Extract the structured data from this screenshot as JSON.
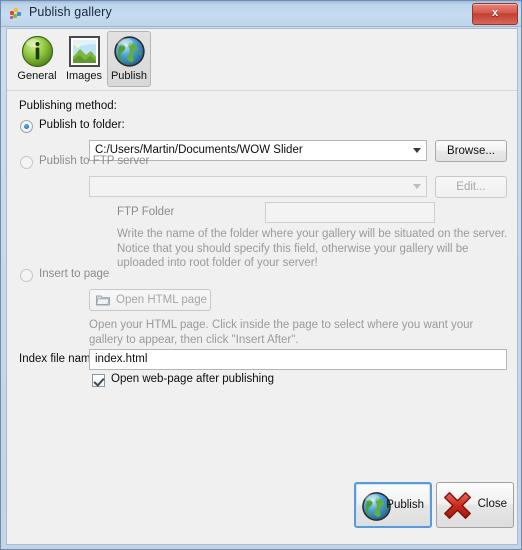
{
  "window": {
    "title": "Publish gallery",
    "app_icon": "colorful-squares-icon",
    "close_label": "x"
  },
  "toolbar": {
    "tabs": [
      {
        "label": "General",
        "icon": "info-globe-icon",
        "selected": false
      },
      {
        "label": "Images",
        "icon": "landscape-image-icon",
        "selected": false
      },
      {
        "label": "Publish",
        "icon": "globe-icon",
        "selected": true
      }
    ]
  },
  "panel": {
    "section_label": "Publishing method:",
    "folder": {
      "radio_label": "Publish to folder:",
      "selected": true,
      "path_value": "C:/Users/Martin/Documents/WOW Slider",
      "browse_label": "Browse..."
    },
    "ftp": {
      "radio_label": "Publish to FTP server",
      "selected": false,
      "server_value": "",
      "edit_label": "Edit...",
      "folder_label": "FTP Folder",
      "folder_value": "",
      "help": "Write the name of the folder where your gallery will be situated on the server. Notice that you should specify this field, otherwise your gallery will be uploaded into root folder of your server!"
    },
    "insert": {
      "radio_label": "Insert to page",
      "selected": false,
      "open_html_label": "Open HTML page",
      "open_html_icon": "folder-icon",
      "help": "Open your HTML page. Click inside the page to select where you want your gallery to appear, then click \"Insert After\"."
    },
    "index": {
      "label": "Index file name",
      "value": "index.html",
      "checkbox_label": "Open web-page after publishing",
      "checkbox_checked": true
    }
  },
  "footer": {
    "publish_label": "Publish",
    "publish_icon": "globe-icon",
    "close_label": "Close",
    "close_icon": "red-x-icon"
  },
  "colors": {
    "titlebar": "#bcd3ea",
    "window_frame": "#6f8bad",
    "client_bg": "#f0f0f0",
    "accent_blue": "#2b79c2",
    "close_red": "#c0392b",
    "help_text": "#9a9a9a",
    "focus_border": "#5b9ad4"
  }
}
